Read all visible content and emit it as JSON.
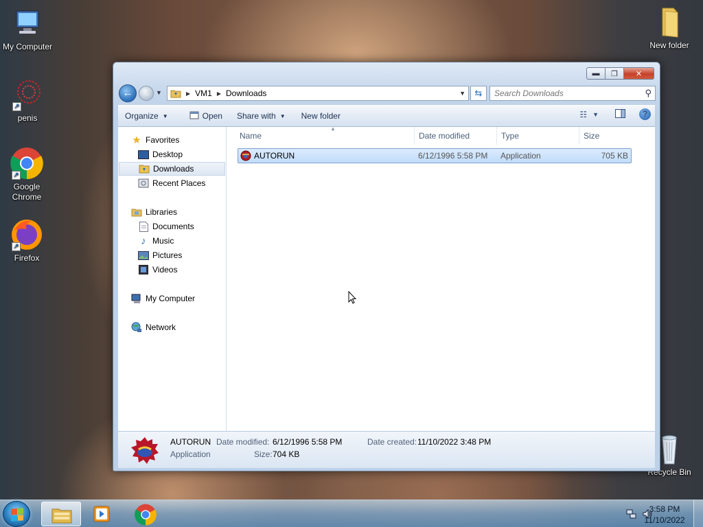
{
  "desktop": {
    "icons": [
      {
        "label": "My Computer"
      },
      {
        "label": "penis"
      },
      {
        "label": "Google Chrome"
      },
      {
        "label": "Firefox"
      },
      {
        "label": "New folder"
      },
      {
        "label": "Recycle Bin"
      }
    ]
  },
  "window": {
    "breadcrumb": [
      "VM1",
      "Downloads"
    ],
    "search_placeholder": "Search Downloads",
    "toolbar": {
      "organize": "Organize",
      "open": "Open",
      "share_with": "Share with",
      "new_folder": "New folder"
    },
    "nav": {
      "favorites": "Favorites",
      "desktop": "Desktop",
      "downloads": "Downloads",
      "recent_places": "Recent Places",
      "libraries": "Libraries",
      "documents": "Documents",
      "music": "Music",
      "pictures": "Pictures",
      "videos": "Videos",
      "my_computer": "My Computer",
      "network": "Network"
    },
    "columns": [
      "Name",
      "Date modified",
      "Type",
      "Size"
    ],
    "files": [
      {
        "name": "AUTORUN",
        "date_modified": "6/12/1996 5:58 PM",
        "type": "Application",
        "size": "705 KB"
      }
    ],
    "details": {
      "name": "AUTORUN",
      "type": "Application",
      "date_modified_label": "Date modified:",
      "date_modified": "6/12/1996 5:58 PM",
      "size_label": "Size:",
      "size": "704 KB",
      "date_created_label": "Date created:",
      "date_created": "11/10/2022 3:48 PM"
    }
  },
  "taskbar": {
    "time": "3:58 PM",
    "date": "11/10/2022"
  },
  "colors": {
    "selection": "#c1dcfa",
    "accent": "#2b6fb8",
    "close_button": "#c6412a"
  }
}
